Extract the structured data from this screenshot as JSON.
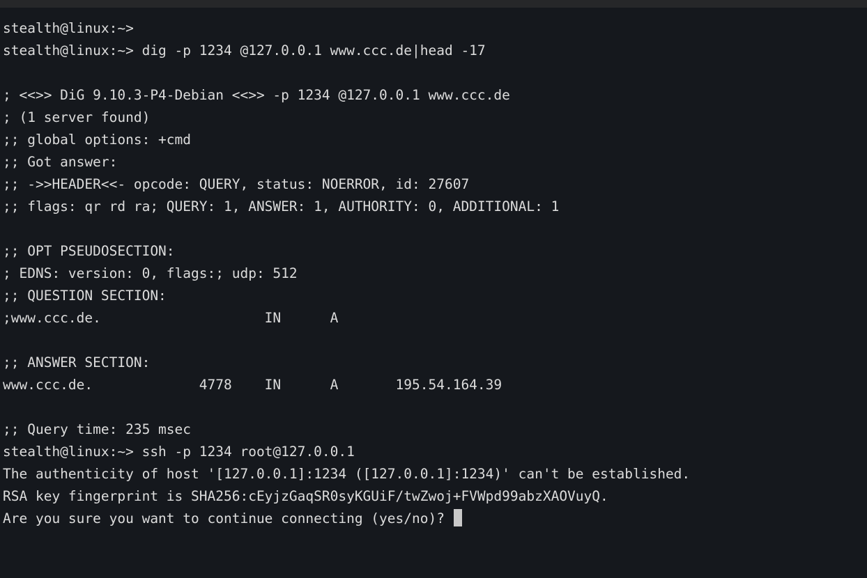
{
  "window": {
    "title_bar_color": "#262729",
    "background_color": "#15181d",
    "foreground_color": "#dcdcdc",
    "cursor_color": "#c9c9c9"
  },
  "terminal": {
    "prompt": "stealth@linux:~>",
    "lines": [
      "stealth@linux:~>",
      "stealth@linux:~> dig -p 1234 @127.0.0.1 www.ccc.de|head -17",
      "",
      "; <<>> DiG 9.10.3-P4-Debian <<>> -p 1234 @127.0.0.1 www.ccc.de",
      "; (1 server found)",
      ";; global options: +cmd",
      ";; Got answer:",
      ";; ->>HEADER<<- opcode: QUERY, status: NOERROR, id: 27607",
      ";; flags: qr rd ra; QUERY: 1, ANSWER: 1, AUTHORITY: 0, ADDITIONAL: 1",
      "",
      ";; OPT PSEUDOSECTION:",
      "; EDNS: version: 0, flags:; udp: 512",
      ";; QUESTION SECTION:",
      ";www.ccc.de.                    IN      A",
      "",
      ";; ANSWER SECTION:",
      "www.ccc.de.             4778    IN      A       195.54.164.39",
      "",
      ";; Query time: 235 msec",
      "stealth@linux:~> ssh -p 1234 root@127.0.0.1",
      "The authenticity of host '[127.0.0.1]:1234 ([127.0.0.1]:1234)' can't be established.",
      "RSA key fingerprint is SHA256:cEyjzGaqSR0syKGUiF/twZwoj+FVWpd99abzXAOVuyQ.",
      "Are you sure you want to continue connecting (yes/no)? "
    ],
    "cursor_line_index": 22,
    "commands": {
      "dig_command": "dig -p 1234 @127.0.0.1 www.ccc.de|head -17",
      "ssh_command": "ssh -p 1234 root@127.0.0.1"
    },
    "dig_result": {
      "version": "DiG 9.10.3-P4-Debian",
      "server": "@127.0.0.1",
      "port": "1234",
      "query_name": "www.ccc.de",
      "opcode": "QUERY",
      "status": "NOERROR",
      "id": "27607",
      "flags": "qr rd ra",
      "counts": {
        "query": "1",
        "answer": "1",
        "authority": "0",
        "additional": "1"
      },
      "edns_version": "0",
      "udp_size": "512",
      "question": {
        "name": ";www.ccc.de.",
        "class": "IN",
        "type": "A"
      },
      "answer": {
        "name": "www.ccc.de.",
        "ttl": "4778",
        "class": "IN",
        "type": "A",
        "address": "195.54.164.39"
      },
      "query_time": "235 msec"
    },
    "ssh_result": {
      "host": "[127.0.0.1]:1234",
      "fingerprint": "SHA256:cEyjzGaqSR0syKGUiF/twZwoj+FVWpd99abzXAOVuyQ.",
      "confirm_question": "Are you sure you want to continue connecting (yes/no)?"
    }
  }
}
